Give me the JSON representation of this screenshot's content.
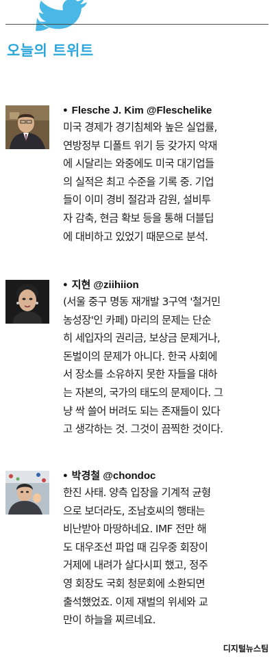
{
  "header": {
    "title": "오늘의 트위트",
    "accent_color": "#2aa6db",
    "icon": "twitter-bird-icon"
  },
  "tweets": [
    {
      "author": "Flesche J. Kim @Fleschelike",
      "lines": [
        "미국 경제가 경기침체와 높은 실업률,",
        "연방정부 디폴트 위기 등 갖가지 악재",
        "에 시달리는 와중에도 미국 대기업들",
        "의 실적은 최고 수준을 기록 중. 기업",
        "들이 이미 경비 절감과 감원, 설비투",
        "자 감축, 현금 확보 등을 통해 더블딥",
        "에 대비하고 있었기 때문으로 분석."
      ]
    },
    {
      "author": "지현 @ziihiion",
      "lines": [
        "(서울 중구 명동 재개발 3구역 '철거민",
        "농성장'인 카페) 마리의 문제는 단순",
        "히 세입자의 권리금, 보상금 문제거나,",
        "돈벌이의 문제가 아니다. 한국 사회에",
        "서 장소를 소유하지 못한 자들을 대하",
        "는 자본의, 국가의 태도의 문제이다. 그",
        "냥 싹 쓸어 버려도 되는 존재들이 있다",
        "고 생각하는 것. 그것이 끔찍한 것이다."
      ]
    },
    {
      "author": "박경철 @chondoc",
      "lines": [
        "한진 사태. 양측 입장을 기계적 균형",
        "으로 보더라도, 조남호씨의 행태는",
        "비난받아 마땅하네요. IMF 전만 해",
        "도 대우조선 파업 때 김우중 회장이",
        "거제에 내려가 살다시피 했고, 정주",
        "영 회장도 국회 청문회에 소환되면",
        "출석했었죠. 이제 재벌의 위세와 교",
        "만이 하늘을 찌르네요."
      ]
    }
  ],
  "footer": {
    "credit": "디지털뉴스팀"
  }
}
